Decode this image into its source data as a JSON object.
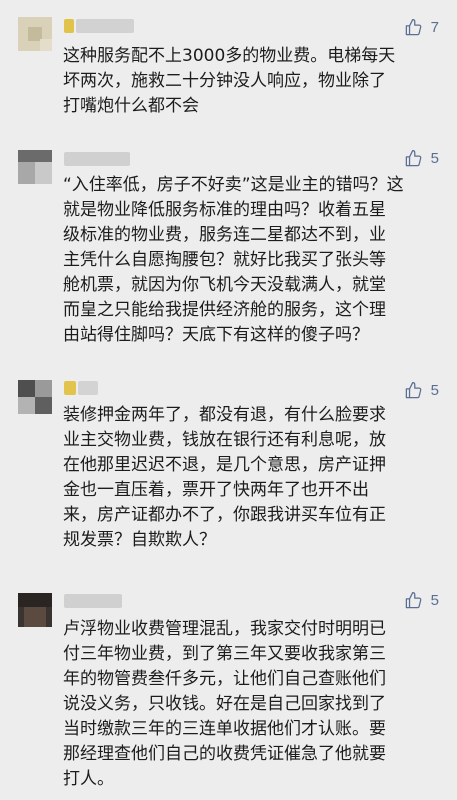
{
  "comments": [
    {
      "likes": "7",
      "lines": [
        "这种服务配不上3000多的物业费。电梯每天",
        "坏两次，施救二十分钟没人响应，物业除了",
        "打嘴炮什么都不会"
      ]
    },
    {
      "likes": "5",
      "lines": [
        "“入住率低，房子不好卖”这是业主的错吗？这",
        "就是物业降低服务标准的理由吗？收着五星",
        "级标准的物业费，服务连二星都达不到，业",
        "主凭什么自愿掏腰包？就好比我买了张头等",
        "舱机票，就因为你飞机今天没载满人，就堂",
        "而皇之只能给我提供经济舱的服务，这个理",
        "由站得住脚吗？天底下有这样的傻子吗？"
      ]
    },
    {
      "likes": "5",
      "lines": [
        "装修押金两年了，都没有退，有什么脸要求",
        "业主交物业费，钱放在银行还有利息呢，放",
        "在他那里迟迟不退，是几个意思，房产证押",
        "金也一直压着，票开了快两年了也开不出",
        "来，房产证都办不了，你跟我讲买车位有正",
        "规发票？自欺欺人？"
      ]
    },
    {
      "likes": "5",
      "lines": [
        "卢浮物业收费管理混乱，我家交付时明明已",
        "付三年物业费，到了第三年又要收我家第三",
        "年的物管费叁仟多元，让他们自己查账他们",
        "说没义务，只收钱。好在是自己回家找到了",
        "当时缴款三年的三连单收据他们才认账。要",
        "那经理查他们自己的收费凭证催急了他就要",
        "打人。"
      ]
    }
  ],
  "icon": {
    "like": "thumbs-up-outline-icon",
    "like_color": "#5a6f93"
  }
}
